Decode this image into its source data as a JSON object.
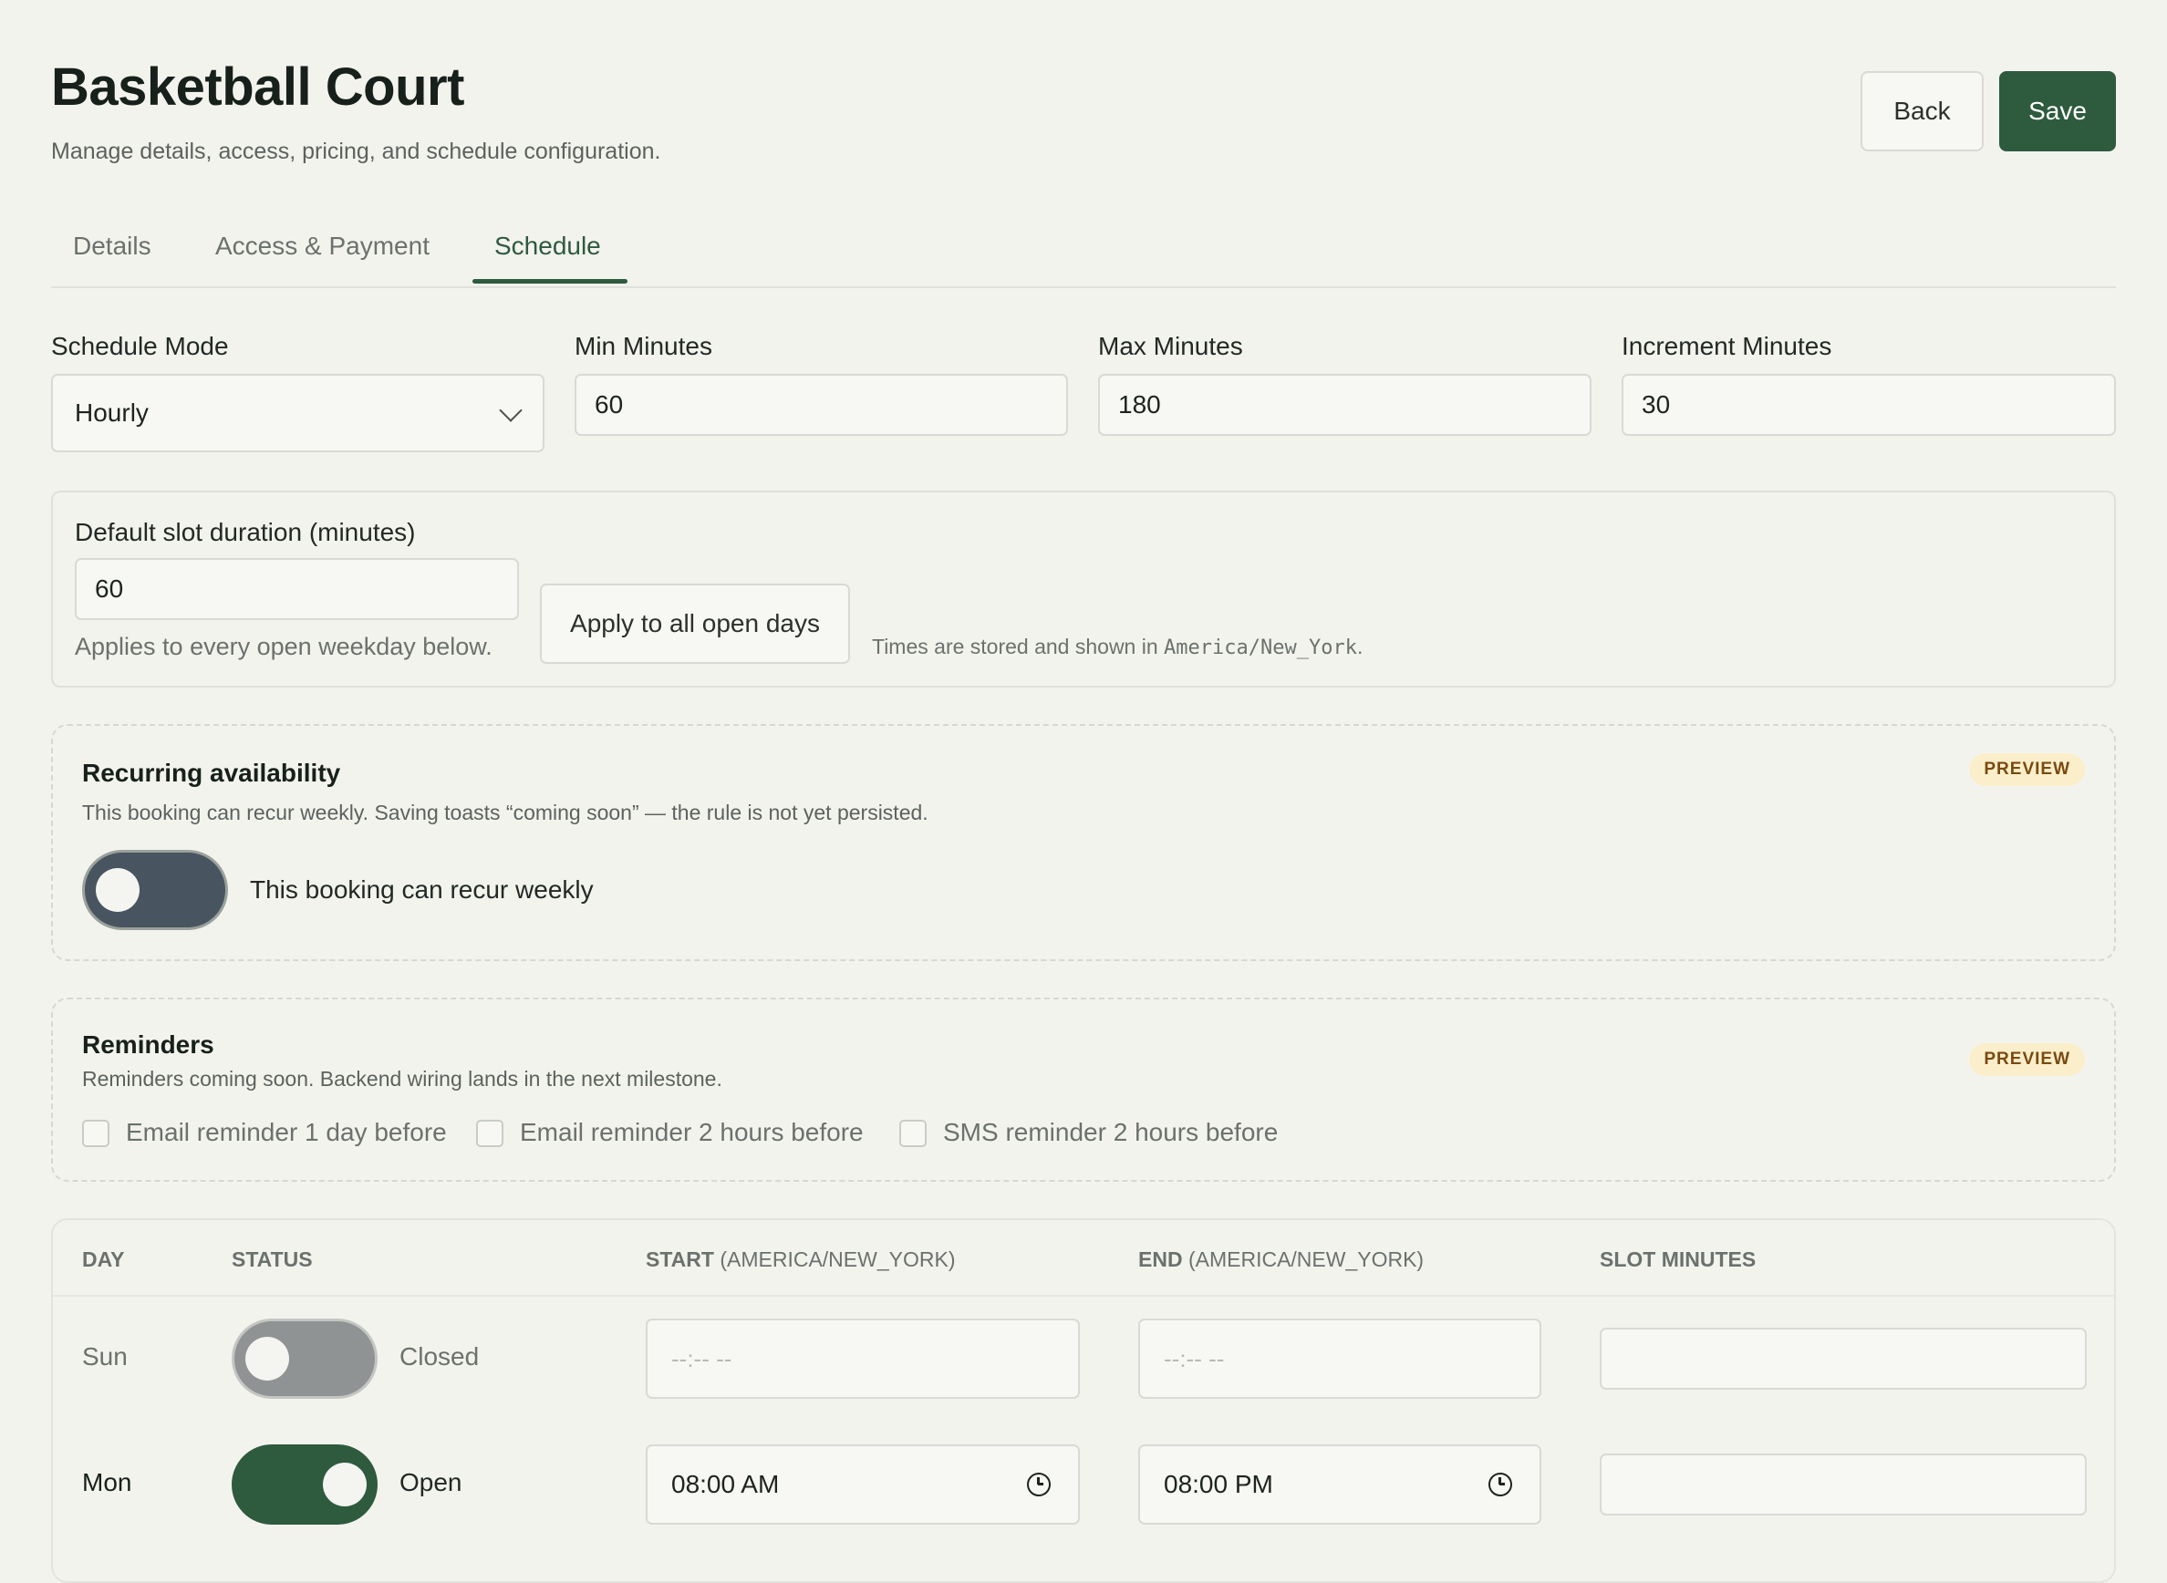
{
  "header": {
    "title": "Basketball Court",
    "subtitle": "Manage details, access, pricing, and schedule configuration.",
    "back_label": "Back",
    "save_label": "Save"
  },
  "tabs": [
    {
      "label": "Details",
      "active": false
    },
    {
      "label": "Access & Payment",
      "active": false
    },
    {
      "label": "Schedule",
      "active": true
    }
  ],
  "schedule": {
    "mode_label": "Schedule Mode",
    "mode_value": "Hourly",
    "min_label": "Min Minutes",
    "min_value": "60",
    "max_label": "Max Minutes",
    "max_value": "180",
    "increment_label": "Increment Minutes",
    "increment_value": "30"
  },
  "default_slot": {
    "label": "Default slot duration (minutes)",
    "value": "60",
    "hint": "Applies to every open weekday below.",
    "apply_label": "Apply to all open days",
    "tz_prefix": "Times are stored and shown in ",
    "tz_value": "America/New_York",
    "tz_suffix": "."
  },
  "recurring": {
    "title": "Recurring availability",
    "badge": "PREVIEW",
    "description": "This booking can recur weekly. Saving toasts “coming soon” — the rule is not yet persisted.",
    "toggle_label": "This booking can recur weekly",
    "enabled": false
  },
  "reminders": {
    "title": "Reminders",
    "badge": "PREVIEW",
    "description": "Reminders coming soon. Backend wiring lands in the next milestone.",
    "options": [
      {
        "label": "Email reminder 1 day before",
        "checked": false
      },
      {
        "label": "Email reminder 2 hours before",
        "checked": false
      },
      {
        "label": "SMS reminder 2 hours before",
        "checked": false
      }
    ]
  },
  "table": {
    "headers": {
      "day": "DAY",
      "status": "STATUS",
      "start": "START",
      "start_tz": "(AMERICA/NEW_YORK)",
      "end": "END",
      "end_tz": "(AMERICA/NEW_YORK)",
      "slot": "SLOT MINUTES"
    },
    "rows": [
      {
        "day": "Sun",
        "status": "Closed",
        "open": false,
        "start": "--:-- --",
        "end": "--:-- --",
        "slot": ""
      },
      {
        "day": "Mon",
        "status": "Open",
        "open": true,
        "start": "08:00 AM",
        "end": "08:00 PM",
        "slot": ""
      }
    ]
  },
  "colors": {
    "accent": "#2e5a3e",
    "background": "#f3f3ee",
    "badge_bg": "#fbefcb",
    "badge_text": "#7a4a10"
  }
}
